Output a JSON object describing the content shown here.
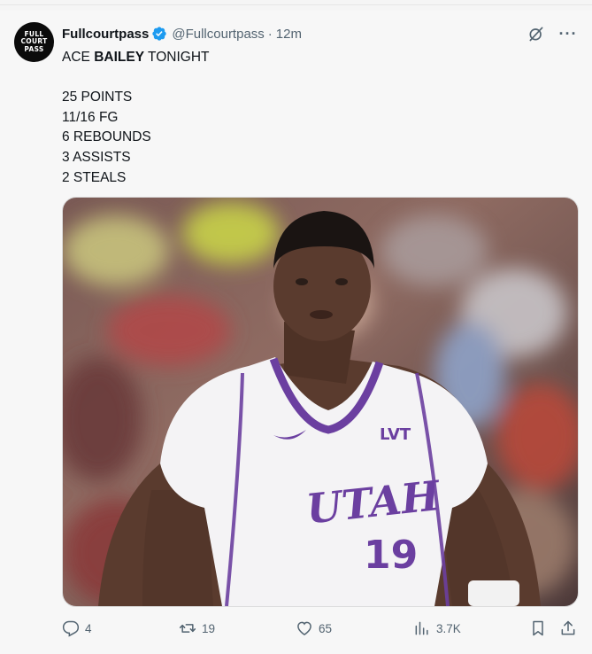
{
  "post": {
    "avatar_text": "FULL\nCOURT\nPASS",
    "display_name": "Fullcourtpass",
    "handle": "@Fullcourtpass",
    "separator": "·",
    "time": "12m",
    "text_first_pre": "ACE ",
    "text_first_bold": "BAILEY",
    "text_first_post": " TONIGHT",
    "stats": [
      "25 POINTS",
      "11/16 FG",
      "6 REBOUNDS",
      "3 ASSISTS",
      "2 STEALS"
    ],
    "media": {
      "jersey_team": "UTAH",
      "jersey_number": "19",
      "jersey_sponsor": "LVT"
    }
  },
  "actions": {
    "replies": "4",
    "reposts": "19",
    "likes": "65",
    "views": "3.7K"
  },
  "colors": {
    "verified": "#1d9bf0",
    "jersey_purple": "#6b3fa0",
    "meta_gray": "#536471"
  },
  "icons": {
    "grok": "grok-icon",
    "more": "more-icon",
    "reply": "reply-icon",
    "repost": "repost-icon",
    "like": "heart-icon",
    "views": "views-icon",
    "bookmark": "bookmark-icon",
    "share": "share-icon"
  }
}
